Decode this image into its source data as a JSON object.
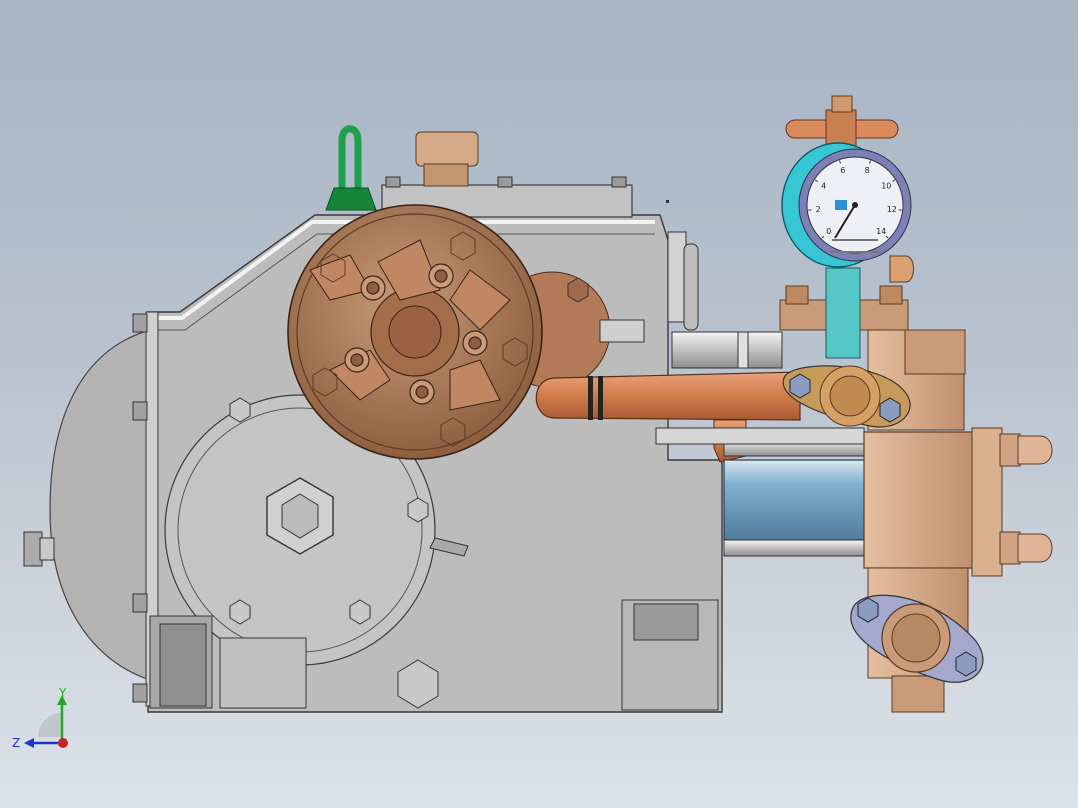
{
  "viewport": {
    "background_top": "#a7b4c4",
    "background_bottom": "#dde2e8"
  },
  "model": {
    "colors": {
      "housing": "#bdbdbd",
      "housing_dark": "#9e9e9e",
      "bronze": "#a87858",
      "copper": "#d9895a",
      "brass": "#d6a882",
      "steel_blue": "#6f9fbf",
      "lifting_eye": "#1fa04a",
      "gauge_ring": "#37c6d6",
      "gauge_face": "#eef0f5",
      "gauge_bolt_plate": "#8f95b8"
    }
  },
  "gauge": {
    "scale": [
      "0",
      "2",
      "4",
      "6",
      "8",
      "10",
      "12",
      "14"
    ]
  },
  "triad": {
    "y_label": "Y",
    "z_label": "Z",
    "colors": {
      "y": "#22aa22",
      "z": "#2233cc",
      "origin": "#cc2222"
    }
  }
}
